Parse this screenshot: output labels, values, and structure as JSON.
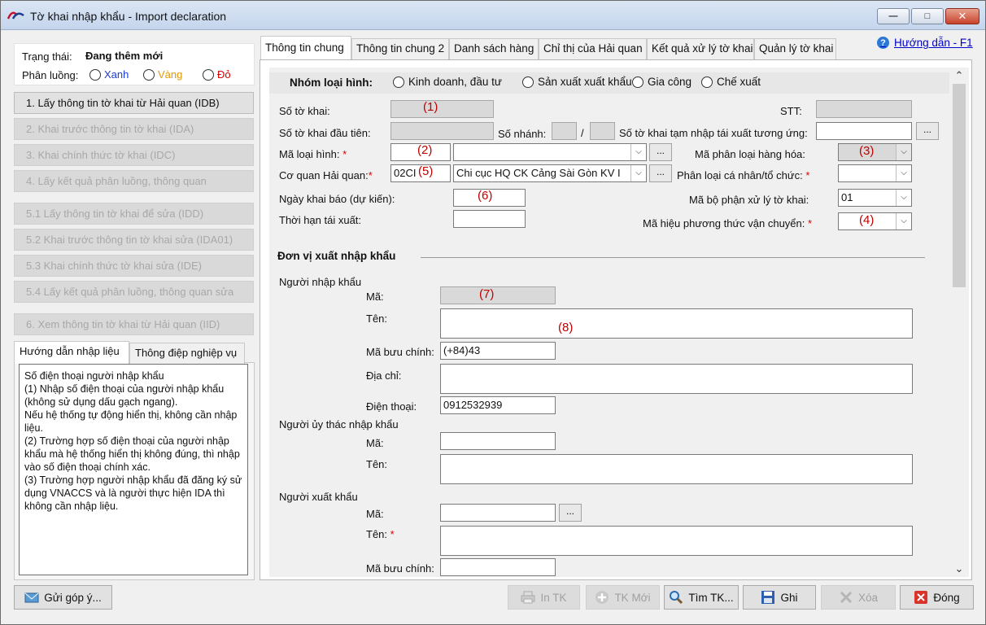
{
  "window": {
    "title": "Tờ khai nhập khẩu - Import declaration"
  },
  "help_link": "Hướng dẫn - F1",
  "status": {
    "label": "Trạng thái:",
    "value": "Đang thêm mới",
    "route_label": "Phân luồng:",
    "routes": [
      {
        "label": "Xanh",
        "color": "#1a3bd6"
      },
      {
        "label": "Vàng",
        "color": "#e39a00"
      },
      {
        "label": "Đỏ",
        "color": "#d40000"
      }
    ]
  },
  "sidebar_buttons": [
    {
      "label": "1. Lấy thông tin tờ khai từ Hải quan (IDB)",
      "enabled": true
    },
    {
      "label": "2. Khai trước thông tin tờ khai (IDA)",
      "enabled": false
    },
    {
      "label": "3. Khai chính thức tờ khai (IDC)",
      "enabled": false
    },
    {
      "label": "4. Lấy kết quả phân luồng, thông quan",
      "enabled": false
    },
    {
      "label": "5.1 Lấy thông tin tờ khai để sửa (IDD)",
      "enabled": false
    },
    {
      "label": "5.2 Khai trước thông tin tờ khai sửa (IDA01)",
      "enabled": false
    },
    {
      "label": "5.3 Khai chính thức tờ khai sửa (IDE)",
      "enabled": false
    },
    {
      "label": "5.4 Lấy kết quả phân luồng, thông quan sửa",
      "enabled": false
    },
    {
      "label": "6. Xem thông tin tờ khai từ Hải quan (IID)",
      "enabled": false
    }
  ],
  "left_tabs": [
    "Hướng dẫn nhập liệu",
    "Thông điệp nghiệp vụ"
  ],
  "help_text": "Số điện thoại người nhập khẩu\n(1) Nhập số điện thoại của người nhập khẩu (không sử dụng dấu gạch ngang).\nNếu hệ thống tự động hiển thị, không cần nhập liệu.\n(2) Trường hợp số điện thoại của người nhập khẩu mà hệ thống hiển thị không đúng, thì nhập vào số điện thoại chính xác.\n(3) Trường hợp người nhập khẩu đã đăng ký sử dụng VNACCS và là người thực hiện IDA thì không cần nhập liệu.",
  "tabs": [
    "Thông tin chung",
    "Thông tin chung 2",
    "Danh sách hàng",
    "Chỉ thị của Hải quan",
    "Kết quả xử lý tờ khai",
    "Quản lý tờ khai"
  ],
  "group": {
    "label": "Nhóm loại hình:",
    "options": [
      "Kinh doanh, đầu tư",
      "Sản xuất xuất khẩu",
      "Gia công",
      "Chế xuất"
    ]
  },
  "fields": {
    "so_to_khai": "Số tờ khai:",
    "stt": "STT:",
    "so_to_khai_dau_tien": "Số tờ khai đầu tiên:",
    "so_nhanh": "Số nhánh:",
    "slash": "/",
    "so_tk_tam_nhap": "Số tờ khai tạm nhập tái xuất tương ứng:",
    "ma_loai_hinh": "Mã loại hình:",
    "ma_phan_loai_hang_hoa": "Mã phân loại hàng hóa:",
    "co_quan_hai_quan": "Cơ quan Hải quan:",
    "co_quan_code": "02CI",
    "co_quan_name": "Chi cục HQ CK Cảng Sài Gòn KV I",
    "phan_loai_ca_nhan": "Phân loại cá nhân/tổ chức:",
    "ngay_khai_bao": "Ngày khai báo (dự kiến):",
    "ma_bo_phan": "Mã bộ phận xử lý tờ khai:",
    "ma_bo_phan_value": "01",
    "thoi_han_tai_xuat": "Thời hạn tái xuất:",
    "ma_hieu_ptvc": "Mã hiệu phương thức vận chuyển:",
    "required_mark": "*",
    "browse": "..."
  },
  "markers": [
    "(1)",
    "(2)",
    "(3)",
    "(4)",
    "(5)",
    "(6)",
    "(7)",
    "(8)"
  ],
  "section": {
    "title": "Đơn vị xuất nhập khẩu",
    "importer": "Người nhập khẩu",
    "ma": "Mã:",
    "ten": "Tên:",
    "ma_buu_chinh": "Mã bưu chính:",
    "ma_buu_chinh_value": "(+84)43",
    "dia_chi": "Địa chỉ:",
    "dien_thoai": "Điện thoại:",
    "dien_thoai_value": "0912532939",
    "trustee": "Người ủy thác nhập khẩu",
    "exporter": "Người xuất khẩu"
  },
  "bottom": {
    "feedback": "Gửi góp ý...",
    "print": "In TK",
    "new": "TK Mới",
    "find": "Tìm TK...",
    "save": "Ghi",
    "delete": "Xóa",
    "close": "Đóng"
  }
}
